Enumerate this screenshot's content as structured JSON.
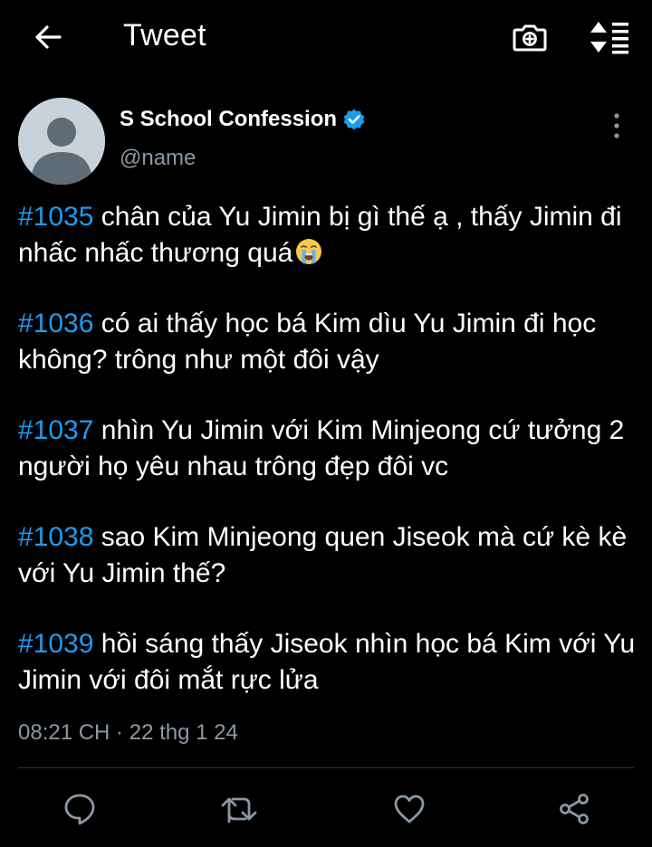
{
  "header": {
    "title": "Tweet",
    "back_icon": "arrow-left-icon",
    "camera_icon": "camera-plus-icon",
    "sort_icon": "sort-lines-icon"
  },
  "author": {
    "display_name": "S School Confession",
    "handle": "@name",
    "verified": true,
    "verified_color": "#1d9bf0"
  },
  "tweet": {
    "paragraphs": [
      {
        "hashtag": "#1035",
        "text": " chân của Yu Jimin bị gì thế ạ , thấy Jimin đi nhấc nhấc thương quá",
        "emoji": "loudly-crying-face-emoji"
      },
      {
        "hashtag": "#1036",
        "text": " có ai thấy học bá Kim dìu Yu Jimin đi học không? trông như một đôi vậy"
      },
      {
        "hashtag": "#1037",
        "text": " nhìn Yu Jimin với Kim Minjeong cứ tưởng 2 người họ yêu nhau trông đẹp đôi vc"
      },
      {
        "hashtag": "#1038",
        "text": " sao Kim Minjeong quen Jiseok mà cứ kè kè với Yu Jimin thế?"
      },
      {
        "hashtag": "#1039",
        "text": " hồi sáng thấy Jiseok nhìn học bá Kim với Yu Jimin với đôi mắt rực lửa"
      }
    ],
    "timestamp": "08:21 CH · 22 thg 1 24"
  },
  "actions": {
    "reply_icon": "reply-icon",
    "retweet_icon": "retweet-icon",
    "like_icon": "heart-icon",
    "share_icon": "share-icon"
  },
  "colors": {
    "background": "#000000",
    "accent": "#1d9bf0",
    "secondary_text": "#8b98a5",
    "icon": "#8b98a5"
  }
}
